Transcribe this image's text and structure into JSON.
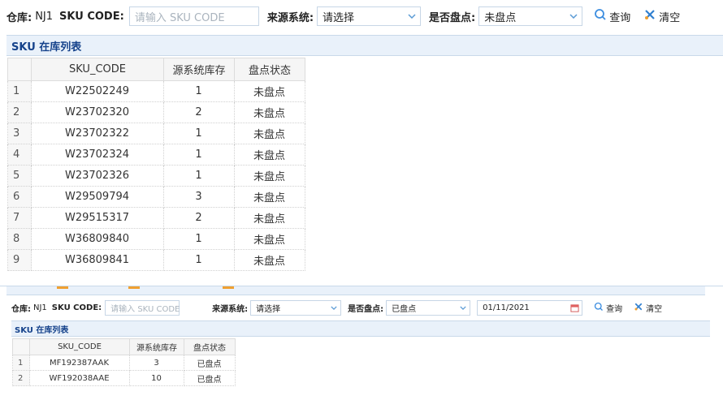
{
  "top": {
    "warehouse_label": "仓库:",
    "warehouse_value": "NJ1",
    "sku_label": "SKU CODE:",
    "sku_placeholder": "请输入 SKU CODE",
    "source_label": "来源系统:",
    "source_value": "请选择",
    "counted_label": "是否盘点:",
    "counted_value": "未盘点",
    "search_label": "查询",
    "clear_label": "清空",
    "section_title": "SKU 在库列表",
    "columns": [
      "SKU_CODE",
      "源系统库存",
      "盘点状态"
    ],
    "rows": [
      {
        "no": "1",
        "sku": "W22502249",
        "qty": "1",
        "status": "未盘点"
      },
      {
        "no": "2",
        "sku": "W23702320",
        "qty": "2",
        "status": "未盘点"
      },
      {
        "no": "3",
        "sku": "W23702322",
        "qty": "1",
        "status": "未盘点"
      },
      {
        "no": "4",
        "sku": "W23702324",
        "qty": "1",
        "status": "未盘点"
      },
      {
        "no": "5",
        "sku": "W23702326",
        "qty": "1",
        "status": "未盘点"
      },
      {
        "no": "6",
        "sku": "W29509794",
        "qty": "3",
        "status": "未盘点"
      },
      {
        "no": "7",
        "sku": "W29515317",
        "qty": "2",
        "status": "未盘点"
      },
      {
        "no": "8",
        "sku": "W36809840",
        "qty": "1",
        "status": "未盘点"
      },
      {
        "no": "9",
        "sku": "W36809841",
        "qty": "1",
        "status": "未盘点"
      }
    ]
  },
  "bottom": {
    "warehouse_label": "仓库:",
    "warehouse_value": "NJ1",
    "sku_label": "SKU CODE:",
    "sku_placeholder": "请输入 SKU CODE",
    "source_label": "来源系统:",
    "source_value": "请选择",
    "counted_label": "是否盘点:",
    "counted_value": "已盘点",
    "date_value": "01/11/2021",
    "search_label": "查询",
    "clear_label": "清空",
    "section_title": "SKU 在库列表",
    "columns": [
      "SKU_CODE",
      "源系统库存",
      "盘点状态"
    ],
    "rows": [
      {
        "no": "1",
        "sku": "MF192387AAK",
        "qty": "3",
        "status": "已盘点"
      },
      {
        "no": "2",
        "sku": "WF192038AAE",
        "qty": "10",
        "status": "已盘点"
      }
    ]
  },
  "colors": {
    "accent": "#5b9bd5",
    "header_bg": "#e9f1fa",
    "title_text": "#15428b"
  }
}
